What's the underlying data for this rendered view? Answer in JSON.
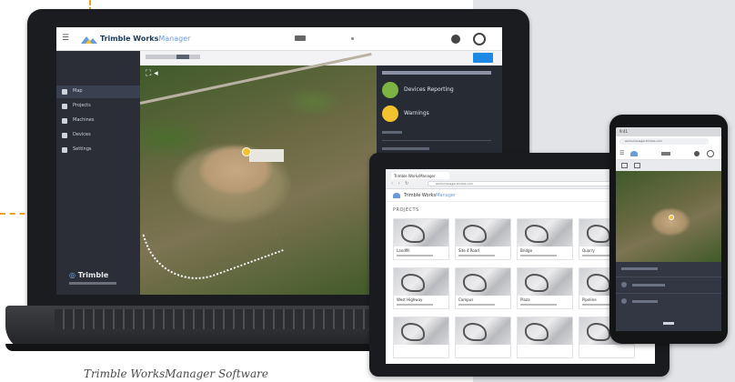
{
  "caption": "Trimble WorksManager Software",
  "laptop": {
    "app": {
      "brand_bold": "Trimble Works",
      "brand_light": "Manager"
    },
    "sidebar": {
      "items": [
        {
          "label": "Map",
          "icon": "map-icon"
        },
        {
          "label": "Projects",
          "icon": "folder-icon"
        },
        {
          "label": "Machines",
          "icon": "excavator-icon"
        },
        {
          "label": "Devices",
          "icon": "device-icon"
        },
        {
          "label": "Settings",
          "icon": "gear-icon"
        }
      ],
      "footer_brand": "Trimble"
    },
    "map_tools": "⛶ ◂",
    "status_panel": {
      "items": [
        {
          "label": "Devices Reporting",
          "color": "#7cb342"
        },
        {
          "label": "Warnings",
          "color": "#f2c230"
        }
      ]
    }
  },
  "tablet": {
    "tab_title": "Trimble WorksManager",
    "url": "worksmanager.trimble.com",
    "brand": {
      "bold": "Trimble Works",
      "light": "Manager"
    },
    "section": "PROJECTS",
    "projects": [
      {
        "name": "Landfill"
      },
      {
        "name": "Site 4 Road"
      },
      {
        "name": "Bridge"
      },
      {
        "name": "Quarry"
      },
      {
        "name": "West Highway"
      },
      {
        "name": "Campus"
      },
      {
        "name": "Plaza"
      },
      {
        "name": "Pipeline"
      }
    ]
  },
  "phone": {
    "time": "9:41",
    "url": "worksmanager.trimble.com"
  },
  "colors": {
    "accent": "#1e88e5",
    "sidebar": "#2b2e36",
    "devices_reporting": "#7cb342",
    "warnings": "#f2c230"
  }
}
